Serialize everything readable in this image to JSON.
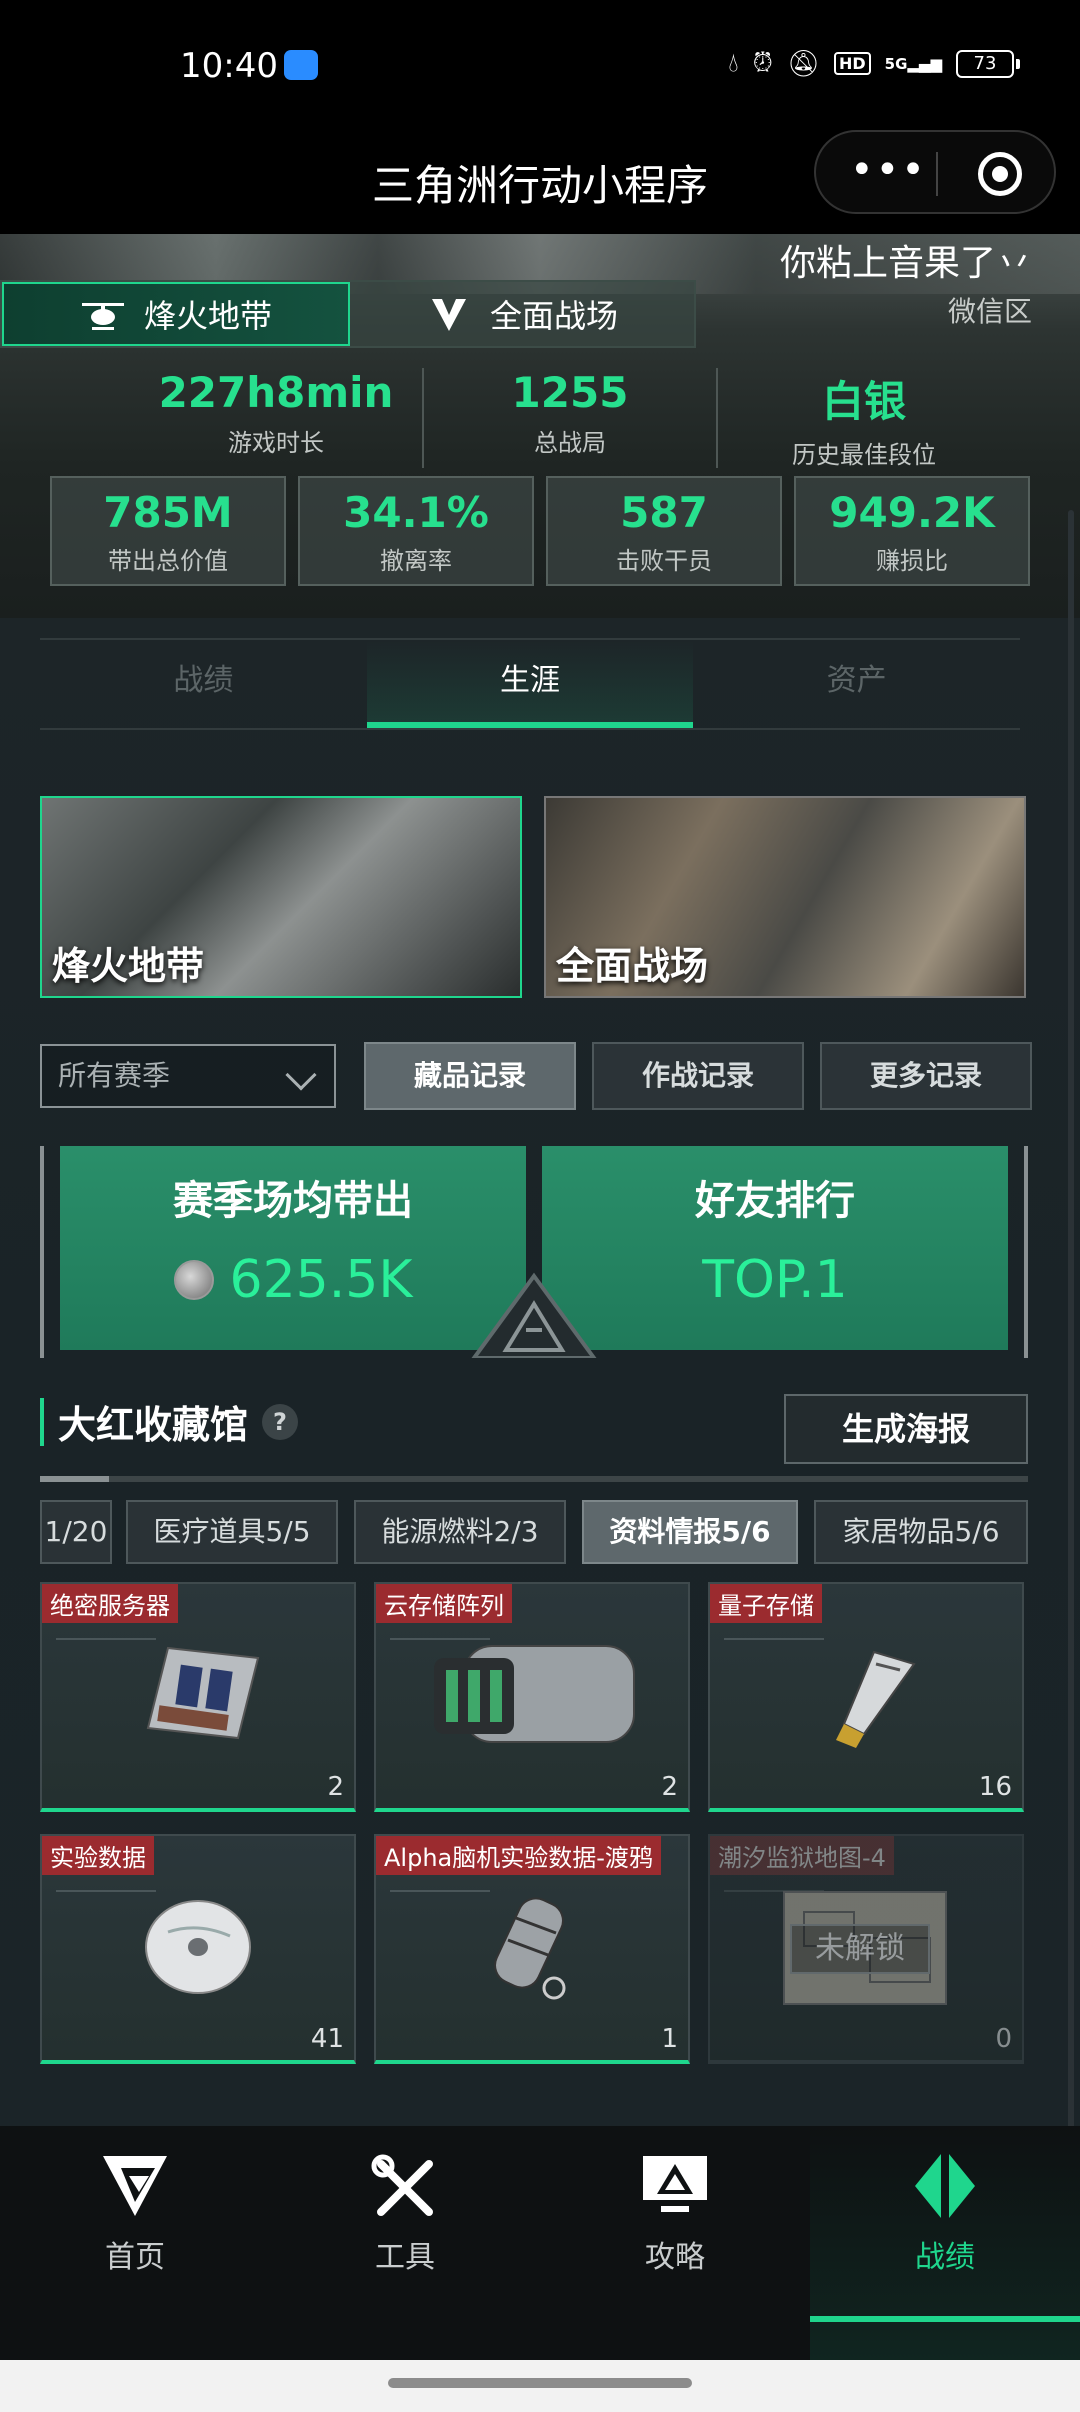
{
  "status_bar": {
    "time": "10:40",
    "network": "5G",
    "hd_label": "HD",
    "battery": "73"
  },
  "nav": {
    "title": "三角洲行动小程序",
    "more_label": "•••"
  },
  "header": {
    "username": "你粘上音果了丷",
    "region": "微信区",
    "mode_tabs": [
      {
        "label": "烽火地带",
        "icon": "helicopter-icon",
        "active": true
      },
      {
        "label": "全面战场",
        "icon": "shield-emblem-icon",
        "active": false
      }
    ],
    "stats": [
      {
        "value": "227h8min",
        "label": "游戏时长"
      },
      {
        "value": "1255",
        "label": "总战局"
      },
      {
        "value": "白银",
        "label": "历史最佳段位"
      }
    ],
    "stat_boxes": [
      {
        "value": "785M",
        "label": "带出总价值"
      },
      {
        "value": "34.1%",
        "label": "撤离率"
      },
      {
        "value": "587",
        "label": "击败干员"
      },
      {
        "value": "949.2K",
        "label": "赚损比"
      }
    ]
  },
  "sub_tabs": [
    {
      "label": "战绩",
      "active": false
    },
    {
      "label": "生涯",
      "active": true
    },
    {
      "label": "资产",
      "active": false
    }
  ],
  "mode_cards": [
    {
      "label": "烽火地带",
      "active": true
    },
    {
      "label": "全面战场",
      "active": false
    }
  ],
  "filter": {
    "season": "所有赛季",
    "buttons": [
      {
        "label": "藏品记录",
        "active": true
      },
      {
        "label": "作战记录",
        "active": false
      },
      {
        "label": "更多记录",
        "active": false
      }
    ]
  },
  "summary": {
    "left_title": "赛季场均带出",
    "left_value": "625.5K",
    "right_title": "好友排行",
    "right_value": "TOP.1"
  },
  "collection": {
    "title": "大红收藏馆",
    "help_icon": "?",
    "poster_button": "生成海报",
    "scroll_progress": 0.07,
    "categories": [
      {
        "label": "1/20",
        "active": false
      },
      {
        "label": "医疗道具5/5",
        "active": false
      },
      {
        "label": "能源燃料2/3",
        "active": false
      },
      {
        "label": "资料情报5/6",
        "active": true
      },
      {
        "label": "家居物品5/6",
        "active": false
      }
    ],
    "items": [
      {
        "name": "绝密服务器",
        "count": "2",
        "icon": "server-icon",
        "locked": false
      },
      {
        "name": "云存储阵列",
        "count": "2",
        "icon": "storage-array-icon",
        "locked": false
      },
      {
        "name": "量子存储",
        "count": "16",
        "icon": "usb-drive-icon",
        "locked": false
      },
      {
        "name": "实验数据",
        "count": "41",
        "icon": "disc-icon",
        "locked": false
      },
      {
        "name": "Alpha脑机实验数据-渡鸦",
        "count": "1",
        "icon": "capsule-device-icon",
        "locked": false
      },
      {
        "name": "潮汐监狱地图-4",
        "count": "0",
        "icon": "map-icon",
        "locked": true,
        "lock_label": "未解锁"
      }
    ]
  },
  "bottom_nav": [
    {
      "label": "首页",
      "icon": "home-logo-icon",
      "active": false
    },
    {
      "label": "工具",
      "icon": "tools-icon",
      "active": false
    },
    {
      "label": "攻略",
      "icon": "guide-monitor-icon",
      "active": false
    },
    {
      "label": "战绩",
      "icon": "record-emblem-icon",
      "active": true
    }
  ],
  "colors": {
    "accent": "#1fd68d",
    "stat_value": "#27e08e",
    "summary_panel": "#2a8f6a",
    "item_tag": "#9b2b2f"
  }
}
